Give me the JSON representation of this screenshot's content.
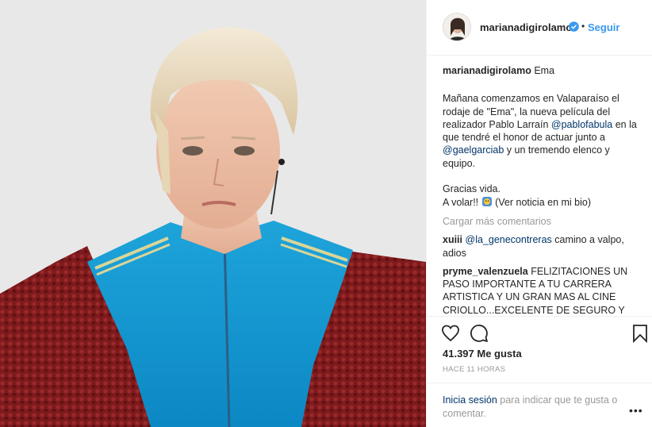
{
  "header": {
    "username": "marianadigirolamo",
    "separator": "•",
    "follow_label": "Seguir"
  },
  "caption": {
    "username": "marianadigirolamo",
    "title": "Ema",
    "text_1": "Mañana comenzamos en Valaparaíso el rodaje de \"Ema\", la nueva película del realizador Pablo Larraín ",
    "mention_1": "@pablofabula",
    "text_2": " en la que tendré el honor de actuar junto a ",
    "mention_2": "@gaelgarciab",
    "text_3": " y un tremendo elenco y equipo.",
    "text_4": "Gracias vida.",
    "text_5a": "A volar!! ",
    "text_5b": " (Ver noticia en mi bio)"
  },
  "load_more": "Cargar más comentarios",
  "comments": [
    {
      "username": "xuiii",
      "mention": "@la_genecontreras",
      "text": " camino a valpo, adios"
    },
    {
      "username": "pryme_valenzuela",
      "mention": "",
      "text": "FELIZITACIONES UN PASO IMPORTANTE A TU CARRERA ARTISTICA Y UN GRAN MAS AL CINE CRIOLLO...EXCELENTE DE SEGURO Y ESTOY MAS QUE CONVENCIDO QUE DARAS LO MEJOR DE TI"
    }
  ],
  "icons": {
    "like": "heart-icon",
    "comment": "comment-bubble-icon",
    "save": "bookmark-icon",
    "verified": "verified-badge-icon",
    "more": "more-options-icon",
    "emoji": "flying-emoji-icon"
  },
  "likes": "41.397 Me gusta",
  "timestamp": "HACE 11 HORAS",
  "login": {
    "link": "Inicia sesión",
    "text": " para indicar que te gusta o comentar."
  },
  "more_options": "•••",
  "colors": {
    "link_blue": "#3897f0",
    "mention_blue": "#003569",
    "muted": "#999999",
    "text": "#262626"
  }
}
